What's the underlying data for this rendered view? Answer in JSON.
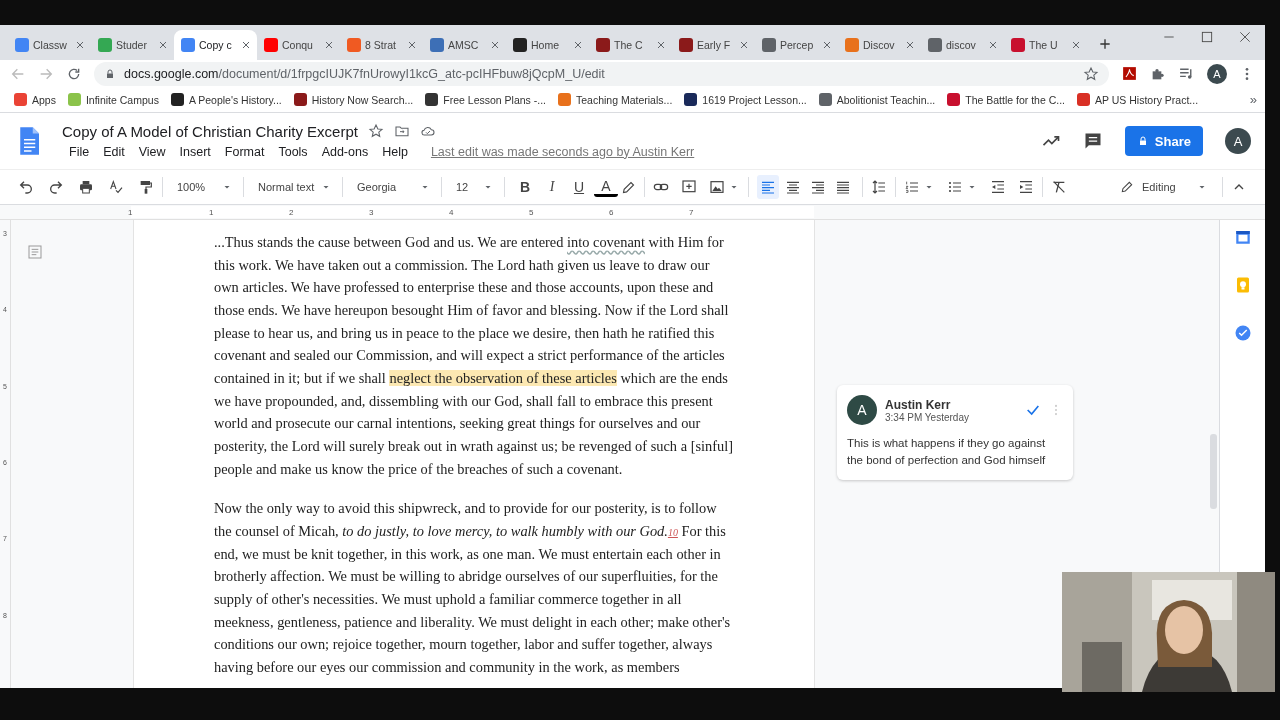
{
  "browser": {
    "tabs": [
      {
        "title": "Classw",
        "color": "#4285f4",
        "selected": false
      },
      {
        "title": "Studer",
        "color": "#34a853",
        "selected": false
      },
      {
        "title": "Copy c",
        "color": "#4285f4",
        "selected": true
      },
      {
        "title": "Conqu",
        "color": "#ff0000",
        "selected": false
      },
      {
        "title": "8 Strat",
        "color": "#f05a22",
        "selected": false
      },
      {
        "title": "AMSC",
        "color": "#3d6fb6",
        "selected": false
      },
      {
        "title": "Home",
        "color": "#222222",
        "selected": false
      },
      {
        "title": "The C",
        "color": "#8b1a1a",
        "selected": false
      },
      {
        "title": "Early F",
        "color": "#8b1a1a",
        "selected": false
      },
      {
        "title": "Percep",
        "color": "#5f6368",
        "selected": false
      },
      {
        "title": "Discov",
        "color": "#e8711c",
        "selected": false
      },
      {
        "title": "discov",
        "color": "#5f6368",
        "selected": false
      },
      {
        "title": "The U",
        "color": "#c8102e",
        "selected": false
      }
    ],
    "address": {
      "host": "docs.google.com",
      "path": "/document/d/1frpgcIUJK7fnUrowyI1kcG_atc-pcIHFbuw8jQcpM_U/edit"
    },
    "profile_initial": "A",
    "bookmarks": [
      {
        "label": "Apps",
        "color": "#ea4335"
      },
      {
        "label": "Infinite Campus",
        "color": "#8bc34a"
      },
      {
        "label": "A People's History...",
        "color": "#222222"
      },
      {
        "label": "History Now Search...",
        "color": "#8b1a1a"
      },
      {
        "label": "Free Lesson Plans -...",
        "color": "#333333"
      },
      {
        "label": "Teaching Materials...",
        "color": "#e8711c"
      },
      {
        "label": "1619 Project Lesson...",
        "color": "#1a2a5a"
      },
      {
        "label": "Abolitionist Teachin...",
        "color": "#5f6368"
      },
      {
        "label": "The Battle for the C...",
        "color": "#c8102e"
      },
      {
        "label": "AP US History Pract...",
        "color": "#d93025"
      }
    ],
    "bookmarks_overflow": "»"
  },
  "docs": {
    "title": "Copy of A Model of Christian Charity Excerpt",
    "menus": [
      "File",
      "Edit",
      "View",
      "Insert",
      "Format",
      "Tools",
      "Add-ons",
      "Help"
    ],
    "last_edit": "Last edit was made seconds ago by Austin Kerr",
    "share": "Share",
    "account_initial": "A",
    "toolbar": {
      "zoom": "100%",
      "style": "Normal text",
      "font": "Georgia",
      "size": "12",
      "format_buttons": [
        {
          "label": "B",
          "kind": "bold"
        },
        {
          "label": "I",
          "kind": "italic"
        },
        {
          "label": "U",
          "kind": "underline"
        },
        {
          "label": "A",
          "kind": "color"
        }
      ],
      "align_buttons": [
        {
          "kind": "left",
          "selected": true
        },
        {
          "kind": "center",
          "selected": false
        },
        {
          "kind": "right",
          "selected": false
        },
        {
          "kind": "justify",
          "selected": false
        }
      ],
      "mode": "Editing"
    },
    "ruler": [
      "1",
      "1",
      "2",
      "3",
      "4",
      "5",
      "6",
      "7"
    ],
    "side_ruler": [
      "3",
      "4",
      "5",
      "6",
      "7",
      "8"
    ],
    "paragraphs": [
      {
        "segments": [
          {
            "kind": "normal",
            "text": "...Thus stands the cause between God and us. We are entered "
          },
          {
            "kind": "flagged",
            "text": "into covenant"
          },
          {
            "kind": "normal",
            "text": " with Him for this work. We have taken out a commission. The Lord hath given us leave to draw our own articles. We have professed to enterprise these and those accounts, upon these and those ends. We have hereupon besought Him of favor and blessing. Now if the Lord shall please to hear us, and bring us in peace to the place we desire, then hath he ratified this covenant and sealed our Commission, and will expect a strict performance of the articles contained in it; but if we shall "
          },
          {
            "kind": "highlight",
            "text": "neglect the observation of these articles"
          },
          {
            "kind": "normal",
            "text": " which are the ends we have propounded, and, dissembling with our God, shall fall to embrace this present world and prosecute our carnal intentions, seeking great things for ourselves and our posterity, the Lord will surely break out in wrath against us; be revenged of such a [sinful] people and make us know the price of the breaches of such a covenant."
          }
        ]
      },
      {
        "segments": [
          {
            "kind": "normal",
            "text": "Now the only way to avoid this shipwreck, and to provide for our posterity, is to follow the counsel of Micah, "
          },
          {
            "kind": "italic",
            "text": "to do justly, to love mercy, to walk humbly with our God."
          },
          {
            "kind": "footnote",
            "text": "10"
          },
          {
            "kind": "normal",
            "text": " For this end, we must be knit together, in this work, as one man. We must entertain each other in brotherly affection. We must be willing to abridge ourselves of our superfluities, for the supply of other's necessities. We must uphold a familiar commerce together in all meekness, gentleness, patience and liberality. We must delight in each other; make other's conditions our own; rejoice together, mourn together, labor and suffer together, always having before our eyes our commission and community in the work, as members"
          }
        ]
      }
    ],
    "comment": {
      "initial": "A",
      "author": "Austin Kerr",
      "time": "3:34 PM Yesterday",
      "text": "This is what happens if they go against the bond of perfection and God himself"
    }
  }
}
